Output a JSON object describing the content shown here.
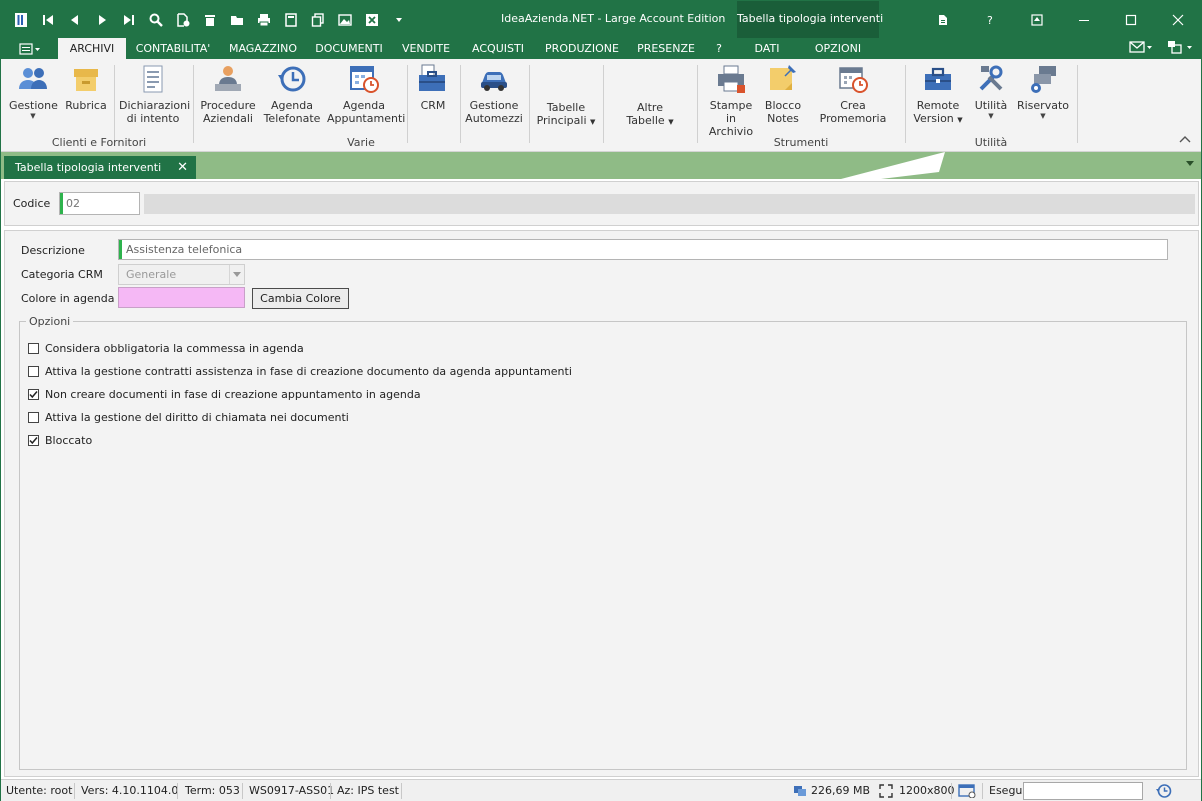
{
  "window": {
    "title": "IdeaAzienda.NET - Large Account Edition",
    "context_title": "Tabella tipologia interventi"
  },
  "ribbon_tabs": [
    "ARCHIVI",
    "CONTABILITA'",
    "MAGAZZINO",
    "DOCUMENTI",
    "VENDITE",
    "ACQUISTI",
    "PRODUZIONE",
    "PRESENZE",
    "?",
    "DATI",
    "OPZIONI"
  ],
  "ribbon": {
    "buttons": {
      "gestione": "Gestione",
      "rubrica": "Rubrica",
      "dichiarazioni_1": "Dichiarazioni",
      "dichiarazioni_2": "di intento",
      "procedure_1": "Procedure",
      "procedure_2": "Aziendali",
      "agenda_tel_1": "Agenda",
      "agenda_tel_2": "Telefonate",
      "agenda_app_1": "Agenda",
      "agenda_app_2": "Appuntamenti",
      "crm": "CRM",
      "automezzi_1": "Gestione",
      "automezzi_2": "Automezzi",
      "tabelle_1": "Tabelle",
      "tabelle_2": "Principali",
      "altre_1": "Altre",
      "altre_2": "Tabelle",
      "stampe_1": "Stampe in",
      "stampe_2": "Archivio",
      "blocco_1": "Blocco",
      "blocco_2": "Notes",
      "promemoria": "Crea Promemoria",
      "remote_1": "Remote",
      "remote_2": "Version",
      "utilita": "Utilità",
      "riservato": "Riservato"
    },
    "groups": {
      "clienti": "Clienti e Fornitori",
      "varie": "Varie",
      "strumenti": "Strumenti",
      "utilita": "Utilità"
    }
  },
  "doc_tab": {
    "label": "Tabella tipologia interventi",
    "close": "✕"
  },
  "form": {
    "codice_label": "Codice",
    "codice_value": "02",
    "descrizione_label": "Descrizione",
    "descrizione_value": "Assistenza telefonica",
    "categoria_label": "Categoria CRM",
    "categoria_value": "Generale",
    "colore_label": "Colore in agenda",
    "colore_value": "#f5b8f5",
    "cambia_colore": "Cambia Colore",
    "opzioni_label": "Opzioni",
    "options": [
      {
        "label": "Considera obbligatoria la commessa in agenda",
        "checked": false
      },
      {
        "label": "Attiva la gestione contratti assistenza in fase di creazione documento da agenda appuntamenti",
        "checked": false
      },
      {
        "label": "Non creare documenti in fase di creazione appuntamento in agenda",
        "checked": true
      },
      {
        "label": "Attiva la gestione del diritto di chiamata nei documenti",
        "checked": false
      },
      {
        "label": "Bloccato",
        "checked": true
      }
    ]
  },
  "status": {
    "utente": "Utente: root",
    "versione": "Vers: 4.10.1104.0",
    "term": "Term: 053",
    "workstation": "WS0917-ASS01",
    "azienda": "Az: IPS test",
    "memoria": "226,69 MB",
    "risoluzione": "1200x800",
    "esegui": "Esegui"
  },
  "colors": {
    "accent": "#217346",
    "doc_tab_strip": "#8fbb86",
    "required_marker": "#2eb34d"
  }
}
